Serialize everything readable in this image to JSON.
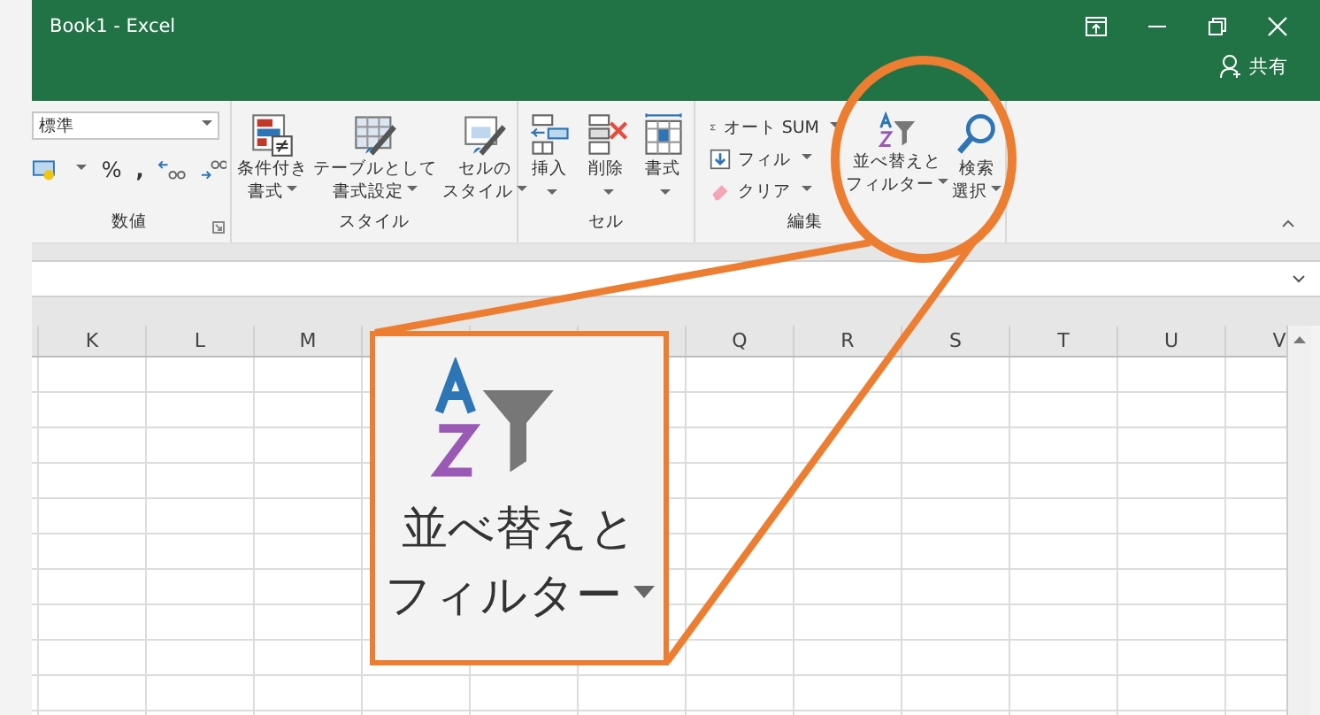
{
  "window": {
    "title": "Book1  -  Excel",
    "share": "共有"
  },
  "ribbon": {
    "number_group": {
      "label": "数値",
      "format": "標準",
      "percent": "%",
      "comma": ","
    },
    "style_group": {
      "label": "スタイル",
      "buttons": [
        {
          "lines": [
            "条件付き",
            "書式"
          ]
        },
        {
          "lines": [
            "テーブルとして",
            "書式設定"
          ]
        },
        {
          "lines": [
            "セルの",
            "スタイル"
          ]
        }
      ]
    },
    "cells_group": {
      "label": "セル",
      "buttons": [
        {
          "lines": [
            "挿入"
          ]
        },
        {
          "lines": [
            "削除"
          ]
        },
        {
          "lines": [
            "書式"
          ]
        }
      ]
    },
    "editing_group": {
      "label": "編集",
      "small_buttons": [
        "オート SUM",
        "フィル",
        "クリア"
      ],
      "buttons": [
        {
          "lines": [
            "並べ替えと",
            "フィルター"
          ]
        },
        {
          "lines": [
            "検索",
            "選択"
          ]
        }
      ]
    }
  },
  "columns_left": [
    "K",
    "L",
    "M"
  ],
  "columns_right": [
    "Q",
    "R",
    "S",
    "T",
    "U",
    "V"
  ],
  "callout": {
    "lines": [
      "並べ替えと",
      "フィルター"
    ]
  }
}
